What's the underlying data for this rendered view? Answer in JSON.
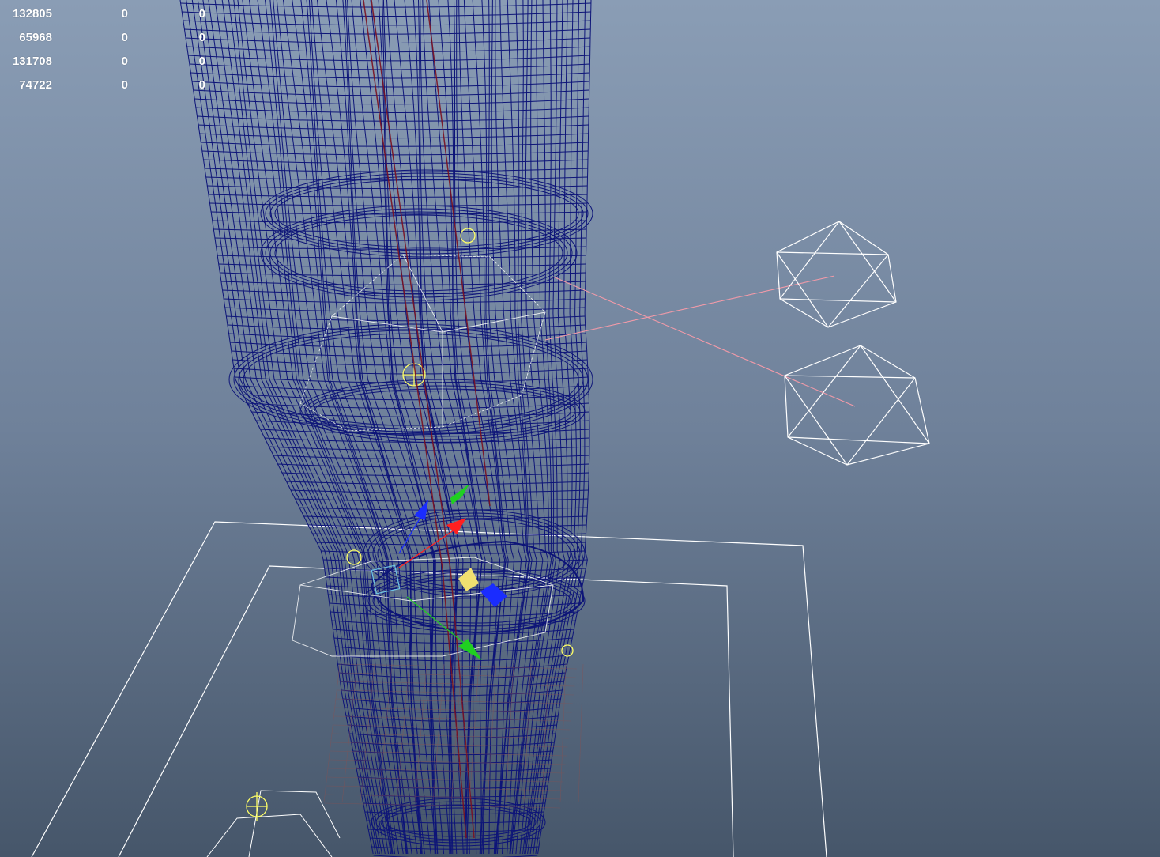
{
  "viewport": {
    "background_top": "#8a9db5",
    "background_bottom": "#46566a",
    "wire_color": "#0d1478",
    "helper_color": "#ffffff",
    "highlight_color": "#ffff66",
    "link_color": "#f29aa8"
  },
  "hud": {
    "rows": [
      {
        "a": "132805",
        "b": "0",
        "c": "0"
      },
      {
        "a": "65968",
        "b": "0",
        "c": "0"
      },
      {
        "a": "131708",
        "b": "0",
        "c": "0"
      },
      {
        "a": "74722",
        "b": "0",
        "c": "0"
      }
    ]
  },
  "manipulator": {
    "icon": "move-manipulator-icon",
    "axis_colors": {
      "x": "#ff2020",
      "y": "#20d020",
      "z": "#1a2cff",
      "center": "#f0e070"
    }
  }
}
